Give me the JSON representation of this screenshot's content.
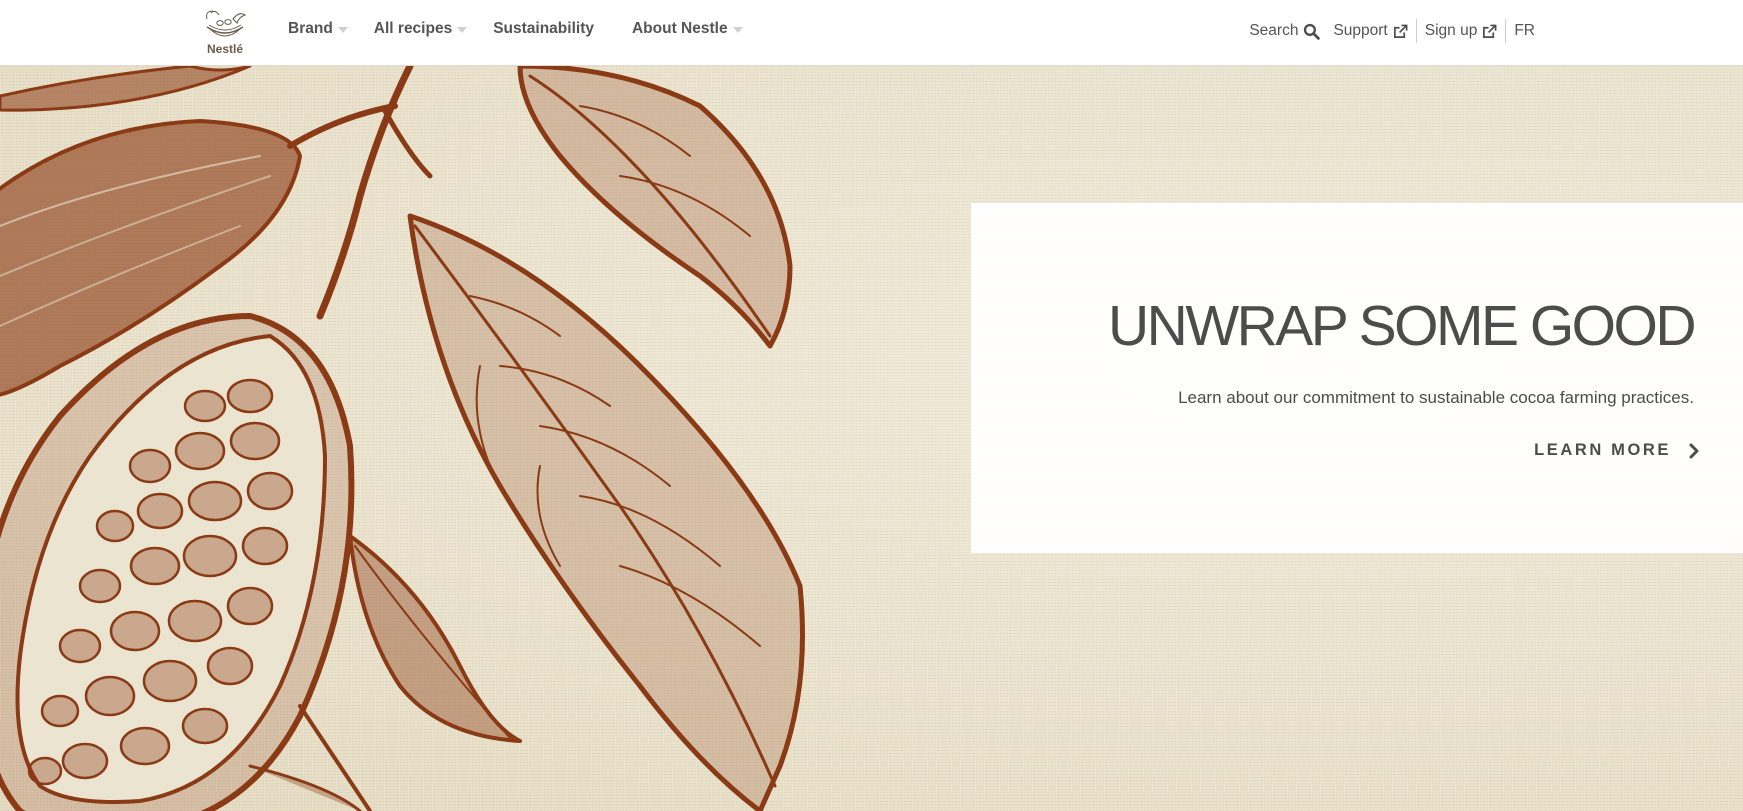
{
  "header": {
    "logo_text": "Nestlé",
    "nav": [
      {
        "label": "Brand",
        "has_dropdown": true
      },
      {
        "label": "All recipes",
        "has_dropdown": true
      },
      {
        "label": "Sustainability",
        "has_dropdown": false
      },
      {
        "label": "About Nestle",
        "has_dropdown": true
      }
    ],
    "utility": {
      "search_label": "Search",
      "search_icon": "search-icon",
      "support_label": "Support",
      "support_icon": "external-link-icon",
      "signup_label": "Sign up",
      "signup_icon": "external-link-icon",
      "language_label": "FR"
    }
  },
  "hero": {
    "illustration": "cocoa-pod-and-leaves-engraving",
    "illustration_color": "#8a3a14",
    "background_color": "#ebe4d0",
    "promo": {
      "title": "UNWRAP SOME GOOD",
      "subtitle": "Learn about our commitment to sustainable cocoa farming practices.",
      "cta_label": "LEARN MORE",
      "cta_icon": "chevron-right-icon"
    }
  },
  "colors": {
    "text": "#4c4c4c",
    "nav_text": "#555555",
    "caret": "#cfcfcf",
    "header_bg": "#ffffff"
  }
}
